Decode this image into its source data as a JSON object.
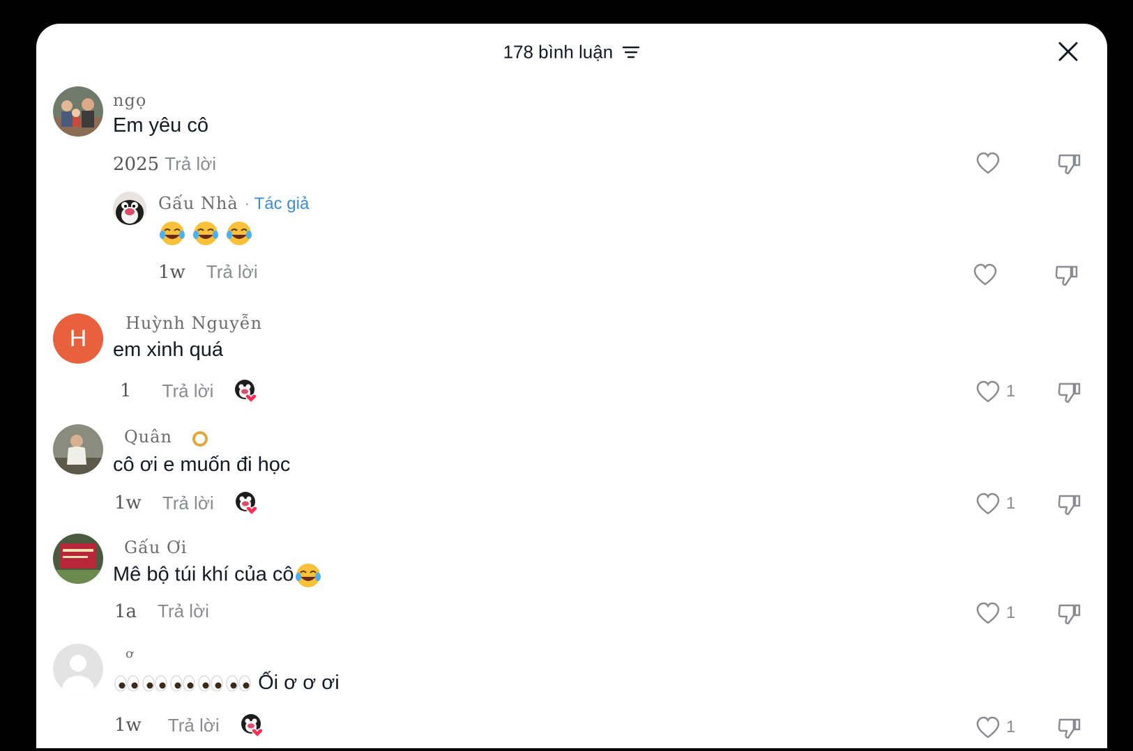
{
  "header": {
    "title": "178 bình luận"
  },
  "comments": [
    {
      "username": "ngọ",
      "text": "Em yêu cô",
      "time": "2025",
      "reply": "Trả lời",
      "likes": ""
    },
    {
      "username": "Gấu Nhà",
      "badge": "Tác giả",
      "text": "",
      "time": "1w",
      "reply": "Trả lời",
      "likes": ""
    },
    {
      "username": "Huỳnh Nguyễn",
      "avatar_letter": "H",
      "text": "em xinh quá",
      "time": "1",
      "reply": "Trả lời",
      "likes": "1"
    },
    {
      "username": "Quân",
      "text": "cô ơi e muốn đi học",
      "time": "1w",
      "reply": "Trả lời",
      "likes": "1"
    },
    {
      "username": "Gấu Ơi",
      "text": "Mê bộ túi khí của cô",
      "time": "1a",
      "reply": "Trả lời",
      "likes": "1"
    },
    {
      "username": "ơ",
      "text": "Ối ơ ơ ơi",
      "time": "1w",
      "reply": "Trả lời",
      "likes": "1"
    }
  ],
  "colors": {
    "author_badge": "#3b8ed0",
    "avatar_letter_bg": "#e8603c"
  }
}
